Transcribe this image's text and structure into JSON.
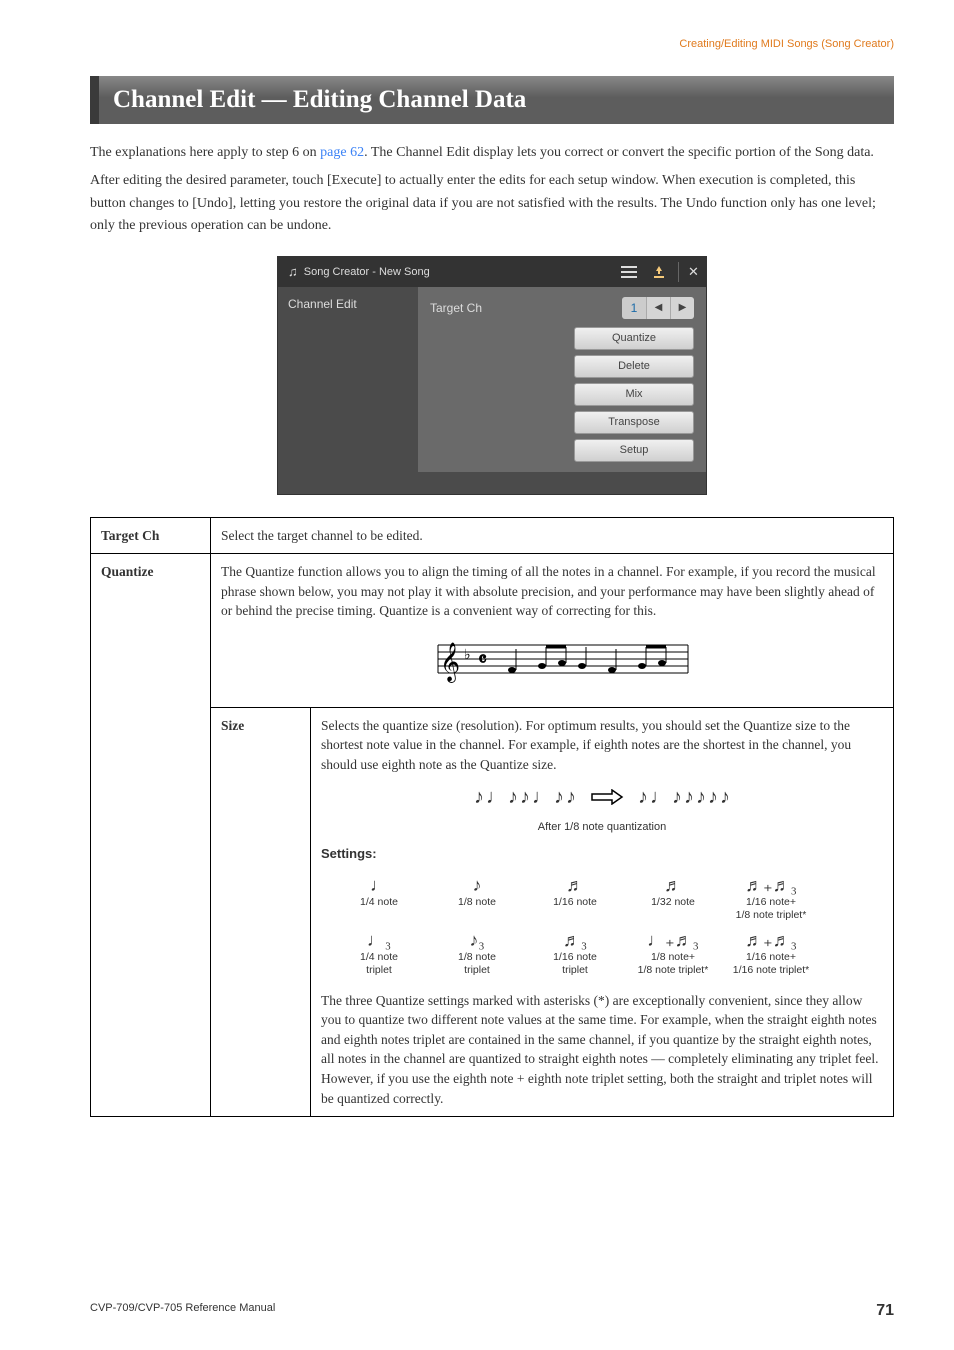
{
  "breadcrumb": "Creating/Editing MIDI Songs (Song Creator)",
  "heading": "Channel Edit — Editing Channel Data",
  "intro1_a": "The explanations here apply to step 6 on ",
  "intro1_link": "page 62",
  "intro1_b": ". The Channel Edit display lets you correct or convert the specific portion of the Song data.",
  "intro2": "After editing the desired parameter, touch [Execute] to actually enter the edits for each setup window. When execution is completed, this button changes to [Undo], letting you restore the original data if you are not satisfied with the results. The Undo function only has one level; only the previous operation can be undone.",
  "screenshot": {
    "title": "Song Creator - New Song",
    "left_tab": "Channel Edit",
    "target_label": "Target Ch",
    "target_value": "1",
    "options": [
      "Quantize",
      "Delete",
      "Mix",
      "Transpose",
      "Setup"
    ]
  },
  "table": {
    "target_ch": {
      "name": "Target Ch",
      "desc": "Select the target channel to be edited."
    },
    "quantize": {
      "name": "Quantize",
      "desc": "The Quantize function allows you to align the timing of all the notes in a channel. For example, if you record the musical phrase shown below, you may not play it with absolute precision, and your performance may have been slightly ahead of or behind the precise timing. Quantize is a convenient way of correcting for this.",
      "size": {
        "name": "Size",
        "desc": "Selects the quantize size (resolution). For optimum results, you should set the Quantize size to the shortest note value in the channel. For example, if eighth notes are the shortest in the channel, you should use eighth note as the Quantize size.",
        "caption": "After 1/8 note quantization",
        "settings_label": "Settings:",
        "row1": [
          {
            "g": "♩",
            "l": "1/4 note",
            "l2": ""
          },
          {
            "g": "♪",
            "l": "1/8 note",
            "l2": ""
          },
          {
            "g": "♬",
            "l": "1/16 note",
            "l2": ""
          },
          {
            "g": "♬",
            "l": "1/32 note",
            "l2": ""
          },
          {
            "g": "♬₊♬₃",
            "l": "1/16 note+",
            "l2": "1/8 note triplet*"
          }
        ],
        "row2": [
          {
            "g": "♩₃",
            "l": "1/4 note",
            "l2": "triplet"
          },
          {
            "g": "♪₃",
            "l": "1/8 note",
            "l2": "triplet"
          },
          {
            "g": "♬₃",
            "l": "1/16 note",
            "l2": "triplet"
          },
          {
            "g": "♩₊♬₃",
            "l": "1/8 note+",
            "l2": "1/8 note triplet*"
          },
          {
            "g": "♬₊♬₃",
            "l": "1/16 note+",
            "l2": "1/16 note triplet*"
          }
        ],
        "note": "The three Quantize settings marked with asterisks (*) are exceptionally convenient, since they allow you to quantize two different note values at the same time. For example, when the straight eighth notes and eighth notes triplet are contained in the same channel, if you quantize by the straight eighth notes, all notes in the channel are quantized to straight eighth notes — completely eliminating any triplet feel. However, if you use the eighth note + eighth note triplet setting, both the straight and triplet notes will be quantized correctly."
      }
    }
  },
  "footer": {
    "left": "CVP-709/CVP-705 Reference Manual",
    "page": "71"
  }
}
